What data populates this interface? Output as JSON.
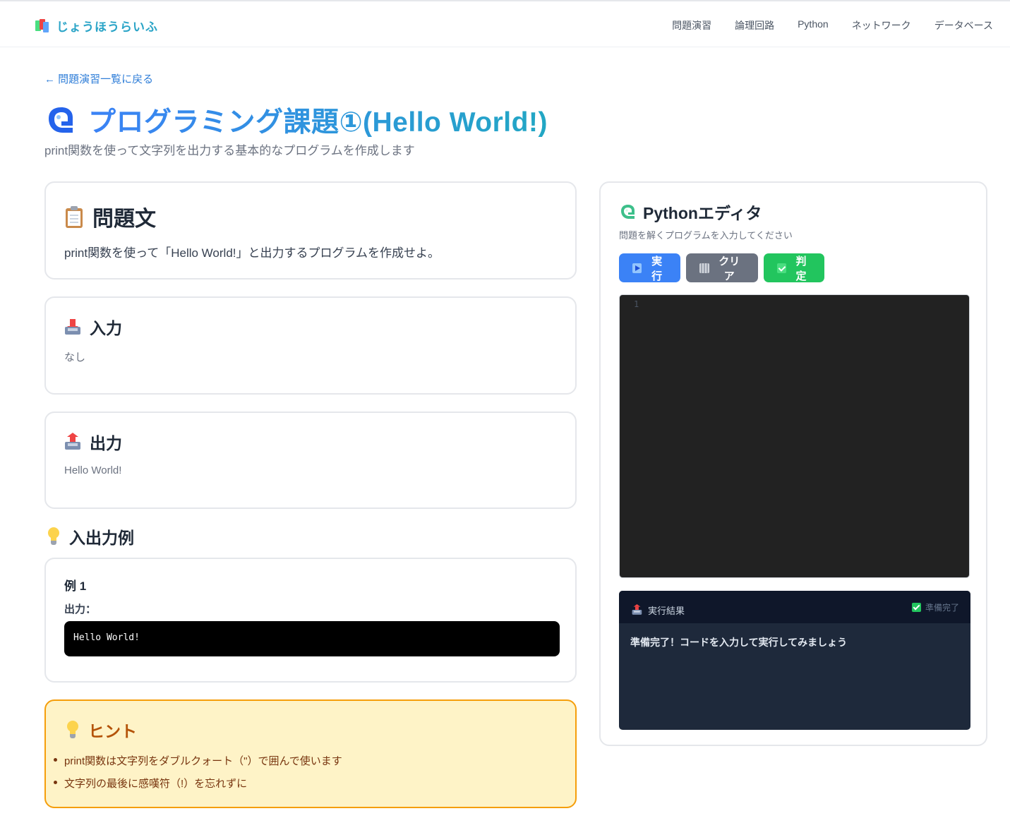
{
  "brand": {
    "name": "じょうほうらいふ"
  },
  "nav": [
    "問題演習",
    "論理回路",
    "Python",
    "ネットワーク",
    "データベース"
  ],
  "page": {
    "back_link": "← 問題演習一覧に戻る",
    "title": "プログラミング課題①(Hello World!)",
    "subtitle": "print関数を使って文字列を出力する基本的なプログラムを作成します"
  },
  "problem": {
    "heading": "問題文",
    "body": "print関数を使って「Hello World!」と出力するプログラムを作成せよ。"
  },
  "input": {
    "heading": "入力",
    "body": "なし"
  },
  "output": {
    "heading": "出力",
    "body": "Hello World!"
  },
  "examples": {
    "heading": "入出力例",
    "items": [
      {
        "title": "例 1",
        "output_label": "出力：",
        "output": "Hello World!"
      }
    ]
  },
  "hint": {
    "heading": "ヒント",
    "items": [
      "print関数は文字列をダブルクォート（\"）で囲んで使います",
      "文字列の最後に感嘆符（!）を忘れずに"
    ]
  },
  "editor": {
    "heading": "Pythonエディタ",
    "subtitle": "問題を解くプログラムを入力してください",
    "buttons": {
      "run": "実行",
      "clear": "クリア",
      "judge": "判定"
    },
    "line_number": "1",
    "code": ""
  },
  "result": {
    "title": "実行結果",
    "status": "準備完了",
    "message": "準備完了！コードを入力して実行してみましょう"
  },
  "colors": {
    "accent_blue": "#3b82f6",
    "accent_teal": "#22a7c4",
    "run_button": "#3b82f6",
    "clear_button": "#6b7280",
    "judge_button": "#22c55e",
    "hint_bg": "#fef3c7",
    "hint_border": "#f59e0b",
    "code_bg": "#222222",
    "result_bg": "#1e293b"
  },
  "icons": {
    "brand": "books-icon",
    "title": "python-logo-icon",
    "problem": "clipboard-icon",
    "input": "inbox-tray-icon",
    "output": "outbox-tray-icon",
    "examples": "light-bulb-icon",
    "hint": "light-bulb-icon",
    "run": "play-icon",
    "clear": "wastebasket-icon",
    "judge": "check-mark-icon"
  }
}
